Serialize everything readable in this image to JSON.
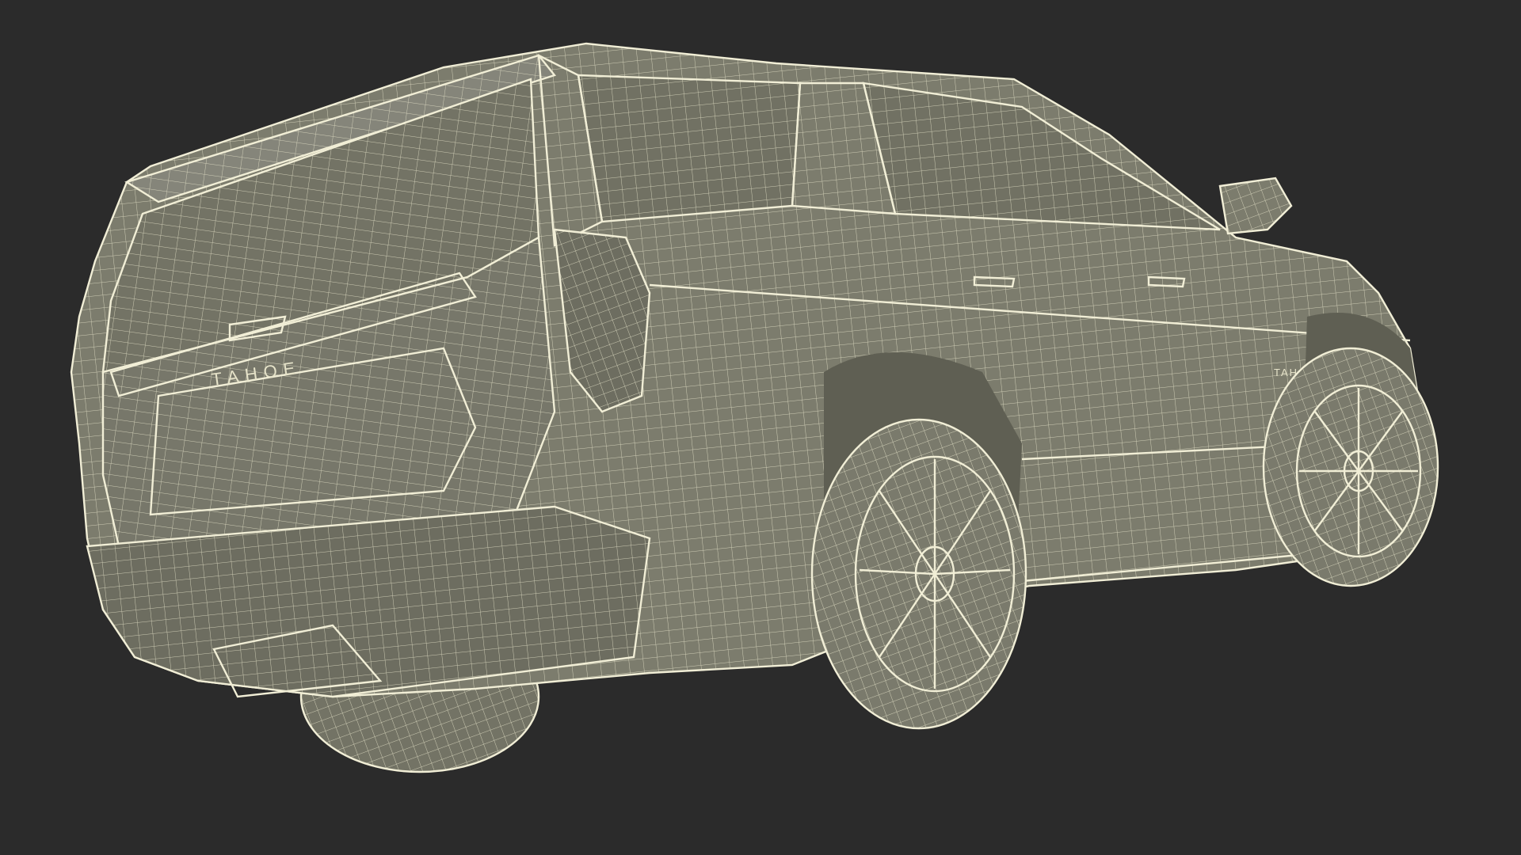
{
  "scene": {
    "background": "#2b2b2b",
    "mesh_fill": "#7c7c6d",
    "mesh_fill_dark": "#666659",
    "wire_color": "#e9e6cc"
  },
  "model": {
    "rear_badge": "TAHOE",
    "side_badge": "TAHOE"
  }
}
